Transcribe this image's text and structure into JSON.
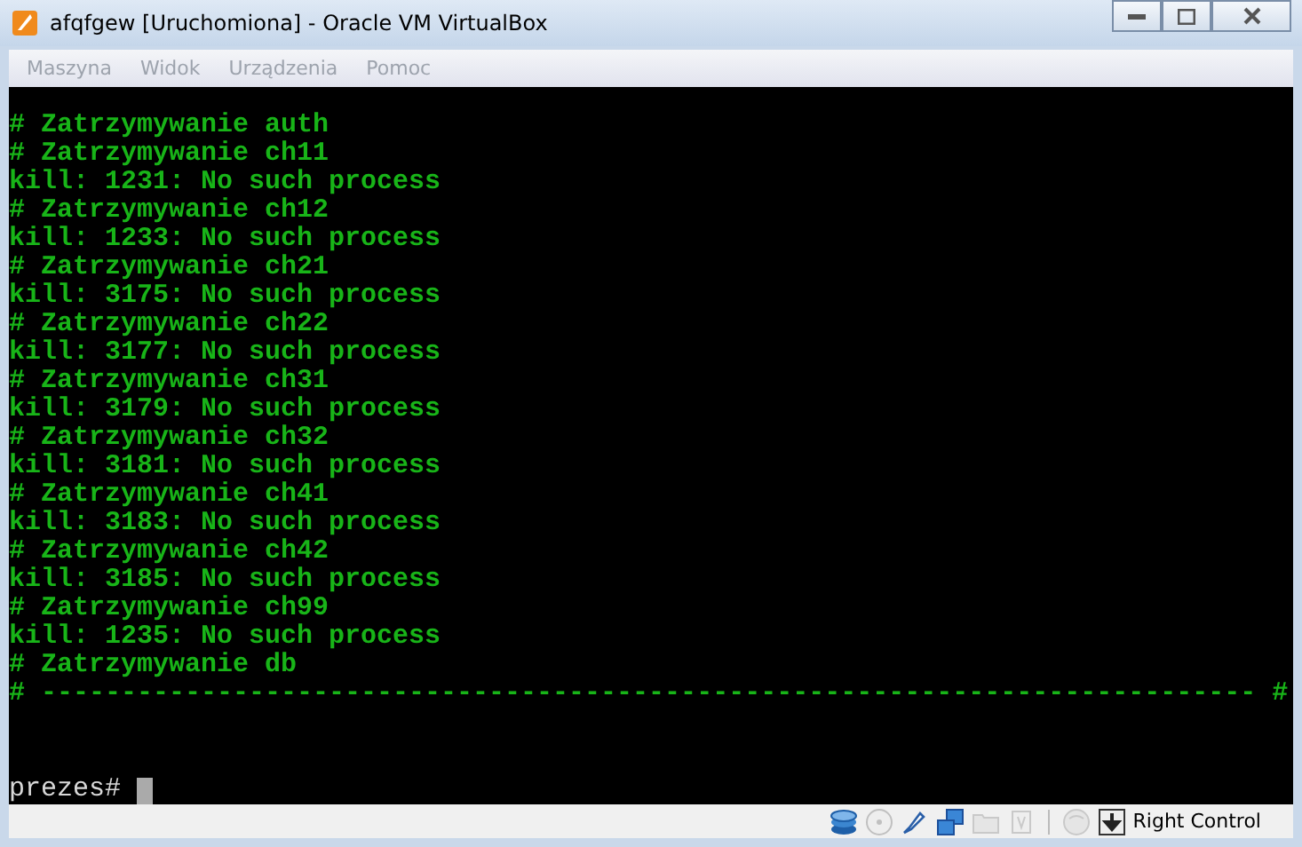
{
  "window": {
    "title": "afqfgew [Uruchomiona] - Oracle VM VirtualBox"
  },
  "menu": [
    {
      "label": "Maszyna",
      "disabled": true
    },
    {
      "label": "Widok",
      "disabled": true
    },
    {
      "label": "Urządzenia",
      "disabled": true
    },
    {
      "label": "Pomoc",
      "disabled": true
    }
  ],
  "console": {
    "lines": [
      "# Zatrzymywanie auth",
      "# Zatrzymywanie ch11",
      "kill: 1231: No such process",
      "# Zatrzymywanie ch12",
      "kill: 1233: No such process",
      "# Zatrzymywanie ch21",
      "kill: 3175: No such process",
      "# Zatrzymywanie ch22",
      "kill: 3177: No such process",
      "# Zatrzymywanie ch31",
      "kill: 3179: No such process",
      "# Zatrzymywanie ch32",
      "kill: 3181: No such process",
      "# Zatrzymywanie ch41",
      "kill: 3183: No such process",
      "# Zatrzymywanie ch42",
      "kill: 3185: No such process",
      "# Zatrzymywanie ch99",
      "kill: 1235: No such process",
      "# Zatrzymywanie db",
      "# ---------------------------------------------------------------------------- #"
    ],
    "prompt": "prezes#"
  },
  "status_bar": {
    "devices": [
      {
        "kind": "disk",
        "disabled": false
      },
      {
        "kind": "optical",
        "disabled": true
      },
      {
        "kind": "usb",
        "disabled": false
      },
      {
        "kind": "network",
        "disabled": false
      },
      {
        "kind": "folder",
        "disabled": true
      },
      {
        "kind": "video",
        "disabled": true
      },
      {
        "kind": "mouse",
        "disabled": true
      }
    ],
    "host_key": "Right Control"
  }
}
